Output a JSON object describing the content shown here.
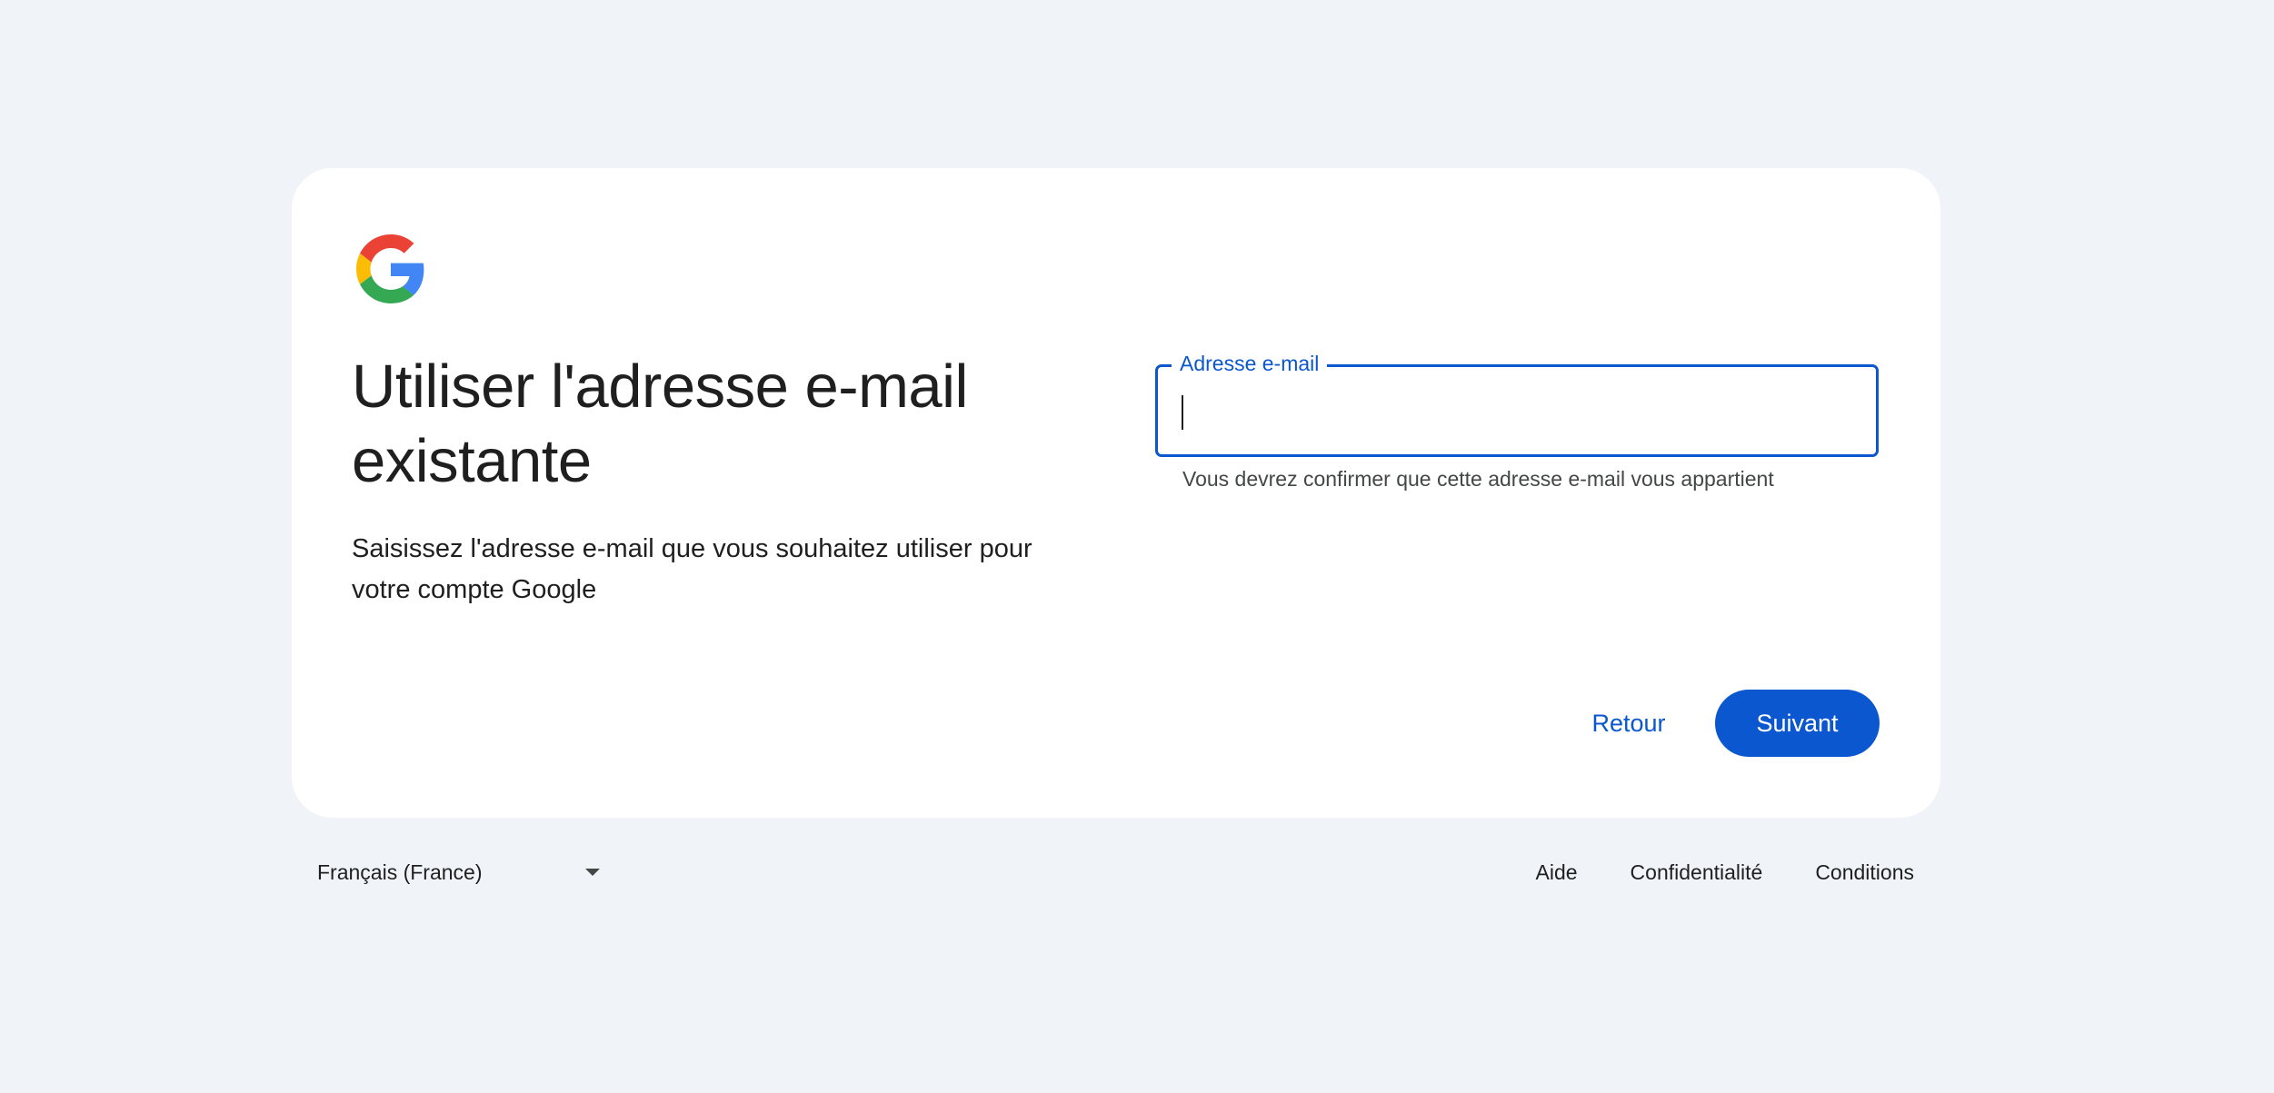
{
  "logo": {
    "name": "google-logo",
    "colors": [
      "#ea4335",
      "#fbbc05",
      "#34a853",
      "#4285f4"
    ]
  },
  "headline": "Utiliser l'adresse e-mail existante",
  "subtitle": "Saisissez l'adresse e-mail que vous souhaitez utiliser pour votre compte Google",
  "email_field": {
    "label": "Adresse e-mail",
    "value": "",
    "helper": "Vous devrez confirmer que cette adresse e-mail vous appartient"
  },
  "buttons": {
    "back": "Retour",
    "next": "Suivant"
  },
  "footer": {
    "language": "Français (France)",
    "links": [
      "Aide",
      "Confidentialité",
      "Conditions"
    ]
  },
  "colors": {
    "accent": "#0b57d0",
    "background": "#f0f4f9",
    "card": "#ffffff"
  }
}
